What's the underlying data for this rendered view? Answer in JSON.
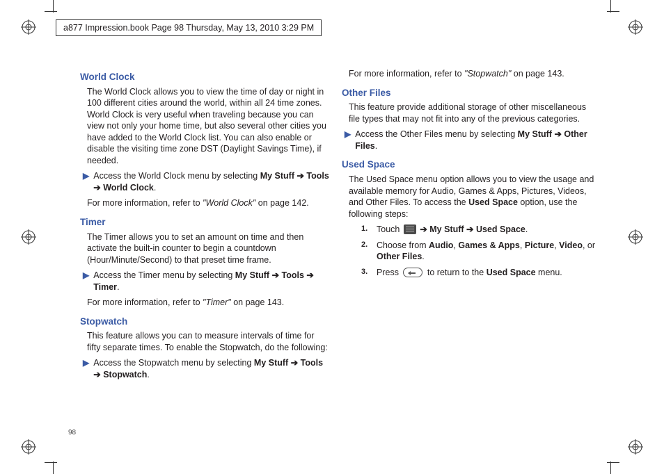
{
  "header": "a877 Impression.book  Page 98  Thursday, May 13, 2010  3:29 PM",
  "page_number": "98",
  "left": {
    "world_clock": {
      "heading": "World Clock",
      "p1": "The World Clock allows you to view the time of day or night in 100 different cities around the world, within all 24 time zones. World Clock is very useful when traveling because you can view not only your home time, but also several other cities you have added to the World Clock list. You can also enable or disable the visiting time zone DST (Daylight Savings Time), if needed.",
      "step_pre": "Access the World Clock menu by selecting ",
      "step_b1": "My Stuff",
      "step_b2": "Tools",
      "step_b3": "World Clock",
      "ref_pre": "For more information, refer to ",
      "ref_q": "\"World Clock\"",
      "ref_post": "  on page 142."
    },
    "timer": {
      "heading": "Timer",
      "p1": "The Timer allows you to set an amount on time and then activate the built-in counter to begin a countdown (Hour/Minute/Second) to that preset time frame.",
      "step_pre": "Access the Timer menu by selecting ",
      "step_b1": "My Stuff",
      "step_b2": "Tools",
      "step_b3": "Timer",
      "ref_pre": "For more information, refer to ",
      "ref_q": "\"Timer\"",
      "ref_post": "  on page 143."
    },
    "stopwatch": {
      "heading": "Stopwatch",
      "p1": "This feature allows you can to measure intervals of time for fifty separate times. To enable the Stopwatch, do the following:",
      "step_pre": "Access the Stopwatch menu by selecting ",
      "step_b1": "My Stuff",
      "step_b2": "Tools",
      "step_b3": "Stopwatch"
    }
  },
  "right": {
    "stopwatch_ref_pre": "For more information, refer to ",
    "stopwatch_ref_q": "\"Stopwatch\"",
    "stopwatch_ref_post": "  on page 143.",
    "other_files": {
      "heading": "Other Files",
      "p1": "This feature provide additional storage of other miscellaneous file types that may not fit into any of the previous categories.",
      "step_pre": "Access the Other Files menu by selecting ",
      "step_b1": "My Stuff",
      "step_b2": "Other Files"
    },
    "used_space": {
      "heading": "Used Space",
      "p1_a": "The Used Space menu option allows you to view the usage and available memory for Audio, Games & Apps, Pictures, Videos, and Other Files. To access the ",
      "p1_b": "Used Space",
      "p1_c": " option, use the following steps:",
      "s1_a": "Touch  ",
      "s1_b": "My Stuff",
      "s1_c": "Used Space",
      "s2_a": "Choose from ",
      "s2_audio": "Audio",
      "s2_games": "Games & Apps",
      "s2_pic": "Picture",
      "s2_video": "Video",
      "s2_or": ", or ",
      "s2_other": "Other Files",
      "s3_a": "Press  ",
      "s3_b": "  to return to the ",
      "s3_c": "Used Space",
      "s3_d": " menu."
    },
    "nums": {
      "n1": "1.",
      "n2": "2.",
      "n3": "3."
    },
    "sep_comma": ", ",
    "sep_arrow": " ➔ ",
    "period": "."
  }
}
